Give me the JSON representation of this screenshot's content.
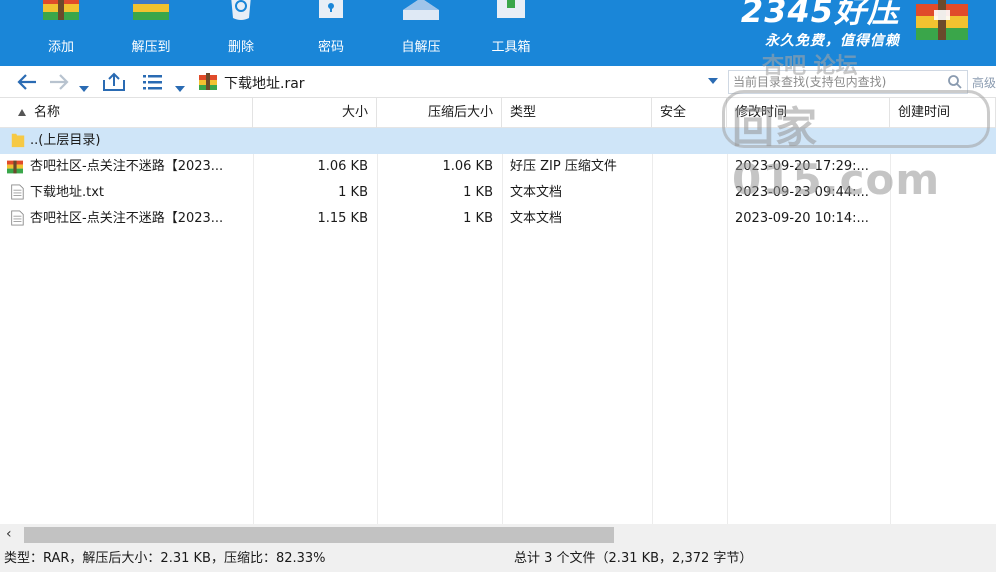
{
  "toolbar": {
    "buttons": [
      {
        "label": "添加",
        "icon": "add-archive-icon"
      },
      {
        "label": "解压到",
        "icon": "extract-to-icon"
      },
      {
        "label": "删除",
        "icon": "delete-icon"
      },
      {
        "label": "密码",
        "icon": "password-icon"
      },
      {
        "label": "自解压",
        "icon": "self-extract-icon"
      },
      {
        "label": "工具箱",
        "icon": "toolbox-icon"
      }
    ],
    "brand_title": "2345好压",
    "brand_slogan": "永久免费，值得信赖",
    "bg_color": "#1a86d8"
  },
  "address": {
    "path": "下载地址.rar",
    "search_placeholder": "当前目录查找(支持包内查找)",
    "advanced": "高级"
  },
  "columns": [
    "名称",
    "大小",
    "压缩后大小",
    "类型",
    "安全",
    "修改时间",
    "创建时间"
  ],
  "rows": [
    {
      "name": "..(上层目录)",
      "size": "",
      "packed": "",
      "type": "",
      "security": "",
      "modified": "",
      "created": "",
      "icon": "folder-up-icon",
      "selected": true
    },
    {
      "name": "杏吧社区-点关注不迷路【2023...",
      "size": "1.06 KB",
      "packed": "1.06 KB",
      "type": "好压 ZIP 压缩文件",
      "security": "",
      "modified": "2023-09-20 17:29:...",
      "created": "",
      "icon": "zip-archive-icon",
      "selected": false
    },
    {
      "name": "下载地址.txt",
      "size": "1 KB",
      "packed": "1 KB",
      "type": "文本文档",
      "security": "",
      "modified": "2023-09-23 09:44:...",
      "created": "",
      "icon": "text-file-icon",
      "selected": false
    },
    {
      "name": "杏吧社区-点关注不迷路【2023...",
      "size": "1.15 KB",
      "packed": "1 KB",
      "type": "文本文档",
      "security": "",
      "modified": "2023-09-20 10:14:...",
      "created": "",
      "icon": "text-file-icon",
      "selected": false
    }
  ],
  "status": {
    "left": "类型：RAR，解压后大小：2.31 KB，压缩比：82.33%",
    "right": "总计 3 个文件（2.31 KB，2,372 字节）"
  },
  "watermark": {
    "line1": "杏吧  论坛",
    "line2": "回家015.com"
  }
}
